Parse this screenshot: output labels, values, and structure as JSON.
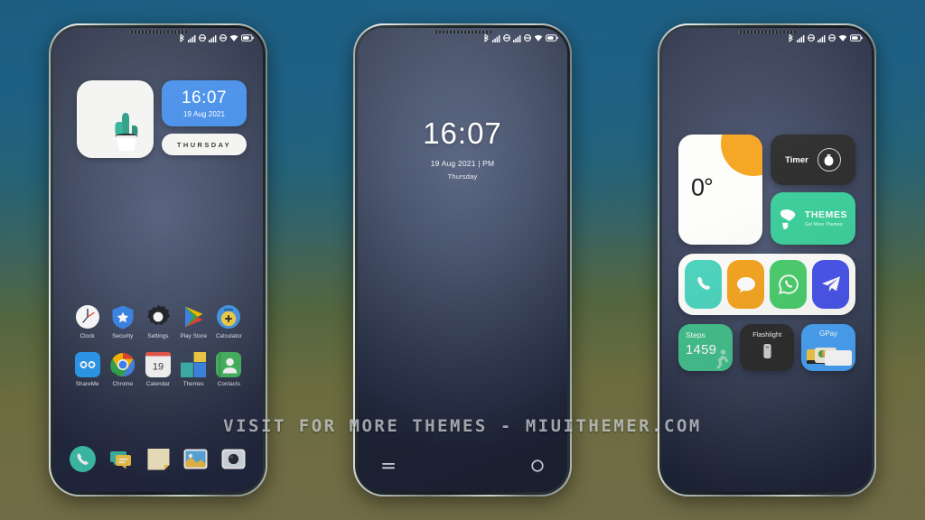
{
  "watermark": "VISIT FOR MORE THEMES - MIUITHEMER.COM",
  "background": {
    "top_color": "#1a5a7c",
    "bottom_color": "#6f6c46"
  },
  "statusbar": {
    "icons": [
      "bluetooth-icon",
      "signal-bars-icon",
      "sim-circle-icon",
      "signal-bars-icon",
      "sim-circle-icon",
      "wifi-icon",
      "battery-icon"
    ]
  },
  "phone1": {
    "name": "home-screen",
    "widgets": {
      "cactus": {
        "label": "cactus-plant-widget"
      },
      "clock": {
        "time": "16:07",
        "date": "19 Aug 2021",
        "color": "#4b92ea"
      },
      "day": {
        "text": "THURSDAY"
      }
    },
    "apps_row1": [
      {
        "label": "Clock",
        "icon": "clock-icon"
      },
      {
        "label": "Security",
        "icon": "shield-icon"
      },
      {
        "label": "Settings",
        "icon": "gear-icon"
      },
      {
        "label": "Play Store",
        "icon": "play-store-icon"
      },
      {
        "label": "Calculator",
        "icon": "calculator-icon"
      }
    ],
    "apps_row2": [
      {
        "label": "ShareMe",
        "icon": "shareme-icon"
      },
      {
        "label": "Chrome",
        "icon": "chrome-icon"
      },
      {
        "label": "Calendar",
        "icon": "calendar-icon",
        "day": "19"
      },
      {
        "label": "Themes",
        "icon": "themes-icon"
      },
      {
        "label": "Contacts",
        "icon": "contacts-icon"
      }
    ],
    "dock": [
      {
        "label": "Phone",
        "icon": "phone-icon"
      },
      {
        "label": "Messages",
        "icon": "messages-icon"
      },
      {
        "label": "Notes",
        "icon": "notes-icon"
      },
      {
        "label": "Gallery",
        "icon": "gallery-icon"
      },
      {
        "label": "Camera",
        "icon": "camera-icon"
      }
    ]
  },
  "phone2": {
    "name": "lock-screen",
    "time": "16:07",
    "date": "19 Aug 2021 | PM",
    "weekday": "Thursday",
    "nav_left_icon": "equals-menu-icon",
    "nav_right_icon": "circle-camera-icon"
  },
  "phone3": {
    "name": "widgets-screen",
    "weather": {
      "temperature": "0°",
      "accent": "#f5a623"
    },
    "timer": {
      "label": "Timer",
      "icon": "timer-icon",
      "color": "#303030"
    },
    "themes": {
      "title": "THEMES",
      "subtitle": "Get More Themes",
      "color": "#3fcf9c"
    },
    "shortcuts": [
      {
        "label": "Phone",
        "icon": "phone-icon",
        "color": "#4fd6c0"
      },
      {
        "label": "Messages",
        "icon": "messages-bubble-icon",
        "color": "#f5a623"
      },
      {
        "label": "WhatsApp",
        "icon": "whatsapp-icon",
        "color": "#4cce6e"
      },
      {
        "label": "Telegram",
        "icon": "telegram-icon",
        "color": "#4a56ea"
      }
    ],
    "steps": {
      "label": "Steps",
      "value": "1459",
      "color": "#45c08d"
    },
    "flashlight": {
      "label": "Flashlight",
      "icon": "flashlight-icon",
      "color": "#2f2f2f"
    },
    "gpay": {
      "label": "GPay",
      "icon": "gpay-cards-icon",
      "color": "#4aa3f5"
    }
  }
}
